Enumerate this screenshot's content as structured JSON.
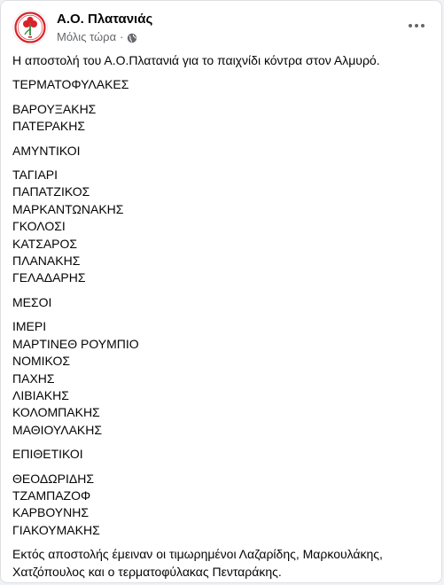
{
  "colors": {
    "text_primary": "#050505",
    "text_secondary": "#65676b",
    "logo_red": "#d8232a",
    "logo_green": "#2e8b3a"
  },
  "header": {
    "page_name": "Α.Ο. Πλατανιάς",
    "timestamp": "Μόλις τώρα",
    "separator": "·",
    "audience_icon": "globe-icon",
    "more_icon": "more-horizontal-icon"
  },
  "post": {
    "intro": "Η αποστολή του Α.Ο.Πλατανιά για το παιχνίδι κόντρα στον Αλμυρό.",
    "groups": [
      {
        "title": "ΤΕΡΜΑΤΟΦΥΛΑΚΕΣ",
        "players": [
          "ΒΑΡΟΥΞΑΚΗΣ",
          "ΠΑΤΕΡΑΚΗΣ"
        ]
      },
      {
        "title": "ΑΜΥΝΤΙΚΟΙ",
        "players": [
          "ΤΑΓΙΑΡΙ",
          "ΠΑΠΑΤΖΙΚΟΣ",
          "ΜΑΡΚΑΝΤΩΝΑΚΗΣ",
          "ΓΚΟΛΟΣΙ",
          "ΚΑΤΣΑΡΟΣ",
          "ΠΛΑΝΑΚΗΣ",
          "ΓΕΛΑΔΑΡΗΣ"
        ]
      },
      {
        "title": "ΜΕΣΟΙ",
        "players": [
          "ΙΜΕΡΙ",
          "ΜΑΡΤΙΝΕΘ ΡΟΥΜΠΙΟ",
          "ΝΟΜΙΚΟΣ",
          "ΠΑΧΗΣ",
          "ΛΙΒΙΑΚΗΣ",
          "ΚΟΛΟΜΠΑΚΗΣ",
          "ΜΑΘΙΟΥΛΑΚΗΣ"
        ]
      },
      {
        "title": "ΕΠΙΘΕΤΙΚΟΙ",
        "players": [
          "ΘΕΟΔΩΡΙΔΗΣ",
          "ΤΖΑΜΠΑΖΟΦ",
          "ΚΑΡΒΟΥΝΗΣ",
          "ΓΙΑΚΟΥΜΑΚΗΣ"
        ]
      }
    ],
    "outro": "Εκτός αποστολής έμειναν οι τιμωρημένοι Λαζαρίδης, Μαρκουλάκης, Χατζόπουλος και ο τερματοφύλακας Πενταράκης."
  }
}
